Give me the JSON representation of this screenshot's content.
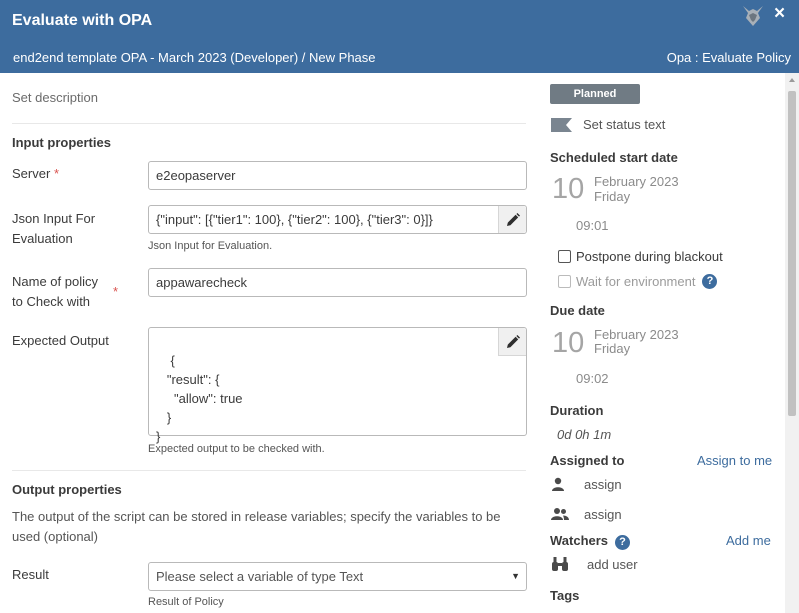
{
  "header": {
    "title": "Evaluate with OPA",
    "breadcrumb": "end2end template OPA - March 2023 (Developer) / New Phase",
    "task_type": "Opa : Evaluate Policy",
    "close_icon": "×",
    "bg_color": "#3d6c9e"
  },
  "left": {
    "set_description": "Set description",
    "input_section": "Input properties",
    "server": {
      "label": "Server",
      "required": "*",
      "value": "e2eopaserver"
    },
    "json_input": {
      "label": "Json Input For Evaluation",
      "value": "{\"input\": [{\"tier1\": 100}, {\"tier2\": 100}, {\"tier3\": 0}]}",
      "help": "Json Input for Evaluation."
    },
    "policy": {
      "label": "Name of policy to Check with",
      "required": "*",
      "value": "appawarecheck"
    },
    "expected": {
      "label": "Expected Output",
      "value": "{\n   \"result\": {\n     \"allow\": true\n   }\n}",
      "help": "Expected output to be checked with."
    },
    "output_section": "Output properties",
    "output_desc": "The output of the script can be stored in release variables; specify the variables to be used (optional)",
    "result": {
      "label": "Result",
      "placeholder": "Please select a variable of type Text",
      "help": "Result of Policy"
    }
  },
  "right": {
    "status_badge": "Planned",
    "status_text": "Set status text",
    "scheduled_label": "Scheduled start date",
    "scheduled": {
      "day": "10",
      "month_year": "February 2023",
      "weekday": "Friday",
      "time": "09:01"
    },
    "postpone": "Postpone during blackout",
    "wait_env": "Wait for environment",
    "help_icon": "?",
    "due_label": "Due date",
    "due": {
      "day": "10",
      "month_year": "February 2023",
      "weekday": "Friday",
      "time": "09:02"
    },
    "duration_label": "Duration",
    "duration": "0d 0h 1m",
    "assigned_label": "Assigned to",
    "assign_to_me": "Assign to me",
    "assign_user": "assign",
    "assign_team": "assign",
    "watchers_label": "Watchers",
    "add_me": "Add me",
    "add_user": "add user",
    "tags_label": "Tags"
  }
}
